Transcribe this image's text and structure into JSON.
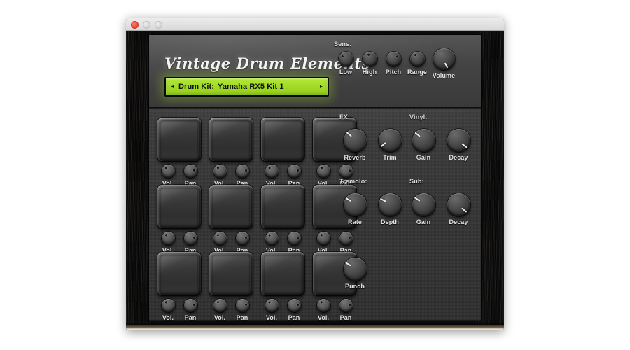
{
  "window": {
    "traffic_lights": [
      "close",
      "minimize",
      "zoom"
    ]
  },
  "plugin": {
    "title": "Vintage Drum Elements",
    "display": {
      "prev_arrow": "◂",
      "next_arrow": "▸",
      "label": "Drum Kit:",
      "value": "Yamaha RX5 Kit 1",
      "bg_color": "#a2dc26",
      "text_color": "#101010"
    },
    "sens": {
      "group_label": "Sens:",
      "knobs": [
        {
          "label": "Low",
          "angle": -145,
          "type": "dot"
        },
        {
          "label": "High",
          "angle": -108,
          "type": "dot"
        },
        {
          "label": "Pitch",
          "angle": -35,
          "type": "dot"
        },
        {
          "label": "Range",
          "angle": -118,
          "type": "dot"
        }
      ]
    },
    "master": {
      "label": "Volume",
      "angle": 64,
      "type": "line"
    },
    "sections": [
      {
        "name": "fx",
        "group_label": "FX:",
        "knobs": [
          {
            "label": "Reverb",
            "angle": -140,
            "type": "line"
          },
          {
            "label": "Trim",
            "angle": 140,
            "type": "line"
          }
        ]
      },
      {
        "name": "vinyl",
        "group_label": "Vinyl:",
        "knobs": [
          {
            "label": "Gain",
            "angle": -142,
            "type": "line"
          },
          {
            "label": "Decay",
            "angle": 38,
            "type": "line"
          }
        ]
      },
      {
        "name": "tremolo",
        "group_label": "Tremolo:",
        "knobs": [
          {
            "label": "Rate",
            "angle": -148,
            "type": "line"
          },
          {
            "label": "Depth",
            "angle": -152,
            "type": "line"
          }
        ]
      },
      {
        "name": "sub",
        "group_label": "Sub:",
        "knobs": [
          {
            "label": "Gain",
            "angle": -145,
            "type": "line"
          },
          {
            "label": "Decay",
            "angle": 40,
            "type": "line"
          }
        ]
      },
      {
        "name": "punch",
        "group_label": "",
        "knobs": [
          {
            "label": "Punch",
            "angle": -150,
            "type": "line"
          }
        ]
      }
    ],
    "pads": {
      "rows": 3,
      "cols": 4,
      "vol_label": "Vol.",
      "pan_label": "Pan",
      "cells": [
        {
          "row": 0,
          "col": 0,
          "vol_angle": -128,
          "pan_angle": -14
        },
        {
          "row": 0,
          "col": 1,
          "vol_angle": -124,
          "pan_angle": -10
        },
        {
          "row": 0,
          "col": 2,
          "vol_angle": -130,
          "pan_angle": -12
        },
        {
          "row": 0,
          "col": 3,
          "vol_angle": -126,
          "pan_angle": -8
        },
        {
          "row": 1,
          "col": 0,
          "vol_angle": -127,
          "pan_angle": -13
        },
        {
          "row": 1,
          "col": 1,
          "vol_angle": -125,
          "pan_angle": -11
        },
        {
          "row": 1,
          "col": 2,
          "vol_angle": -129,
          "pan_angle": -9
        },
        {
          "row": 1,
          "col": 3,
          "vol_angle": -126,
          "pan_angle": -12
        },
        {
          "row": 2,
          "col": 0,
          "vol_angle": -128,
          "pan_angle": -10
        },
        {
          "row": 2,
          "col": 1,
          "vol_angle": -124,
          "pan_angle": -13
        },
        {
          "row": 2,
          "col": 2,
          "vol_angle": -130,
          "pan_angle": -11
        },
        {
          "row": 2,
          "col": 3,
          "vol_angle": -127,
          "pan_angle": -9
        }
      ]
    }
  }
}
